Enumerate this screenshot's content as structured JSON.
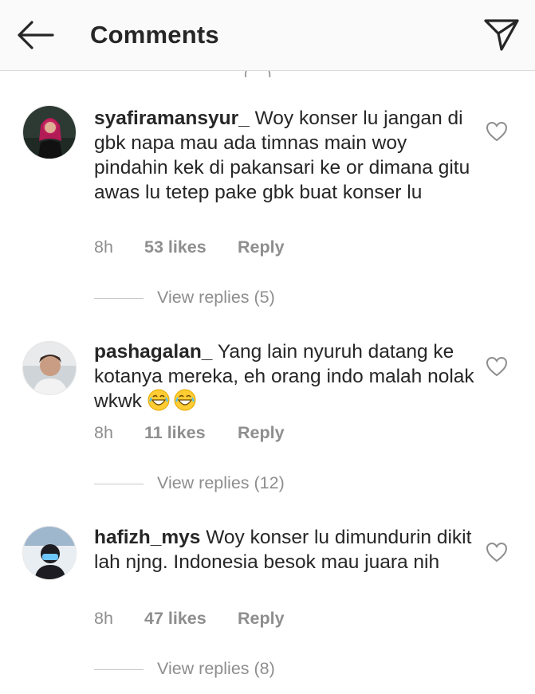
{
  "header": {
    "title": "Comments",
    "back_icon": "arrow-left-icon",
    "share_icon": "paper-plane-icon"
  },
  "comments": [
    {
      "username": "syafiramansyur_",
      "text": "Woy konser lu jangan di gbk napa mau ada timnas main woy pindahin kek di pakansari ke or dimana gitu awas lu tetep pake gbk buat konser lu",
      "time": "8h",
      "likes": "53 likes",
      "reply": "Reply",
      "view_replies": "View replies (5)"
    },
    {
      "username": "pashagalan_",
      "text": "Yang lain nyuruh datang ke kotanya mereka, eh orang indo malah nolak wkwk",
      "emoji": "😂😂",
      "time": "8h",
      "likes": "11 likes",
      "reply": "Reply",
      "view_replies": "View replies (12)"
    },
    {
      "username": "hafizh_mys",
      "text": "Woy konser lu dimundurin dikit lah njng. Indonesia besok mau juara nih",
      "time": "8h",
      "likes": "47 likes",
      "reply": "Reply",
      "view_replies": "View replies (8)"
    }
  ],
  "colors": {
    "text": "#262626",
    "muted": "#8e8e8e",
    "header_bg": "#fafafa",
    "divider": "#dbdbdb"
  }
}
